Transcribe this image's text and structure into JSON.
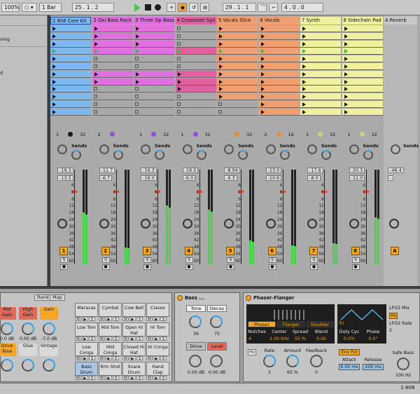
{
  "toolbar": {
    "zoom": "100%",
    "quantize": "1 Bar",
    "pos_bar": "25",
    "pos_beat": "1",
    "pos_sixteenth": "2",
    "loop_bar": "29",
    "loop_beat": "1",
    "loop_sixteenth": "1",
    "length_bar": "4",
    "length_beat": "0",
    "length_sixteenth": "0"
  },
  "browser": {
    "items": [
      "ving",
      "d"
    ]
  },
  "tracks": [
    {
      "name": "1 808 Core Kit",
      "color": "#7db8f0",
      "selected": true,
      "clips": [
        1,
        1,
        1,
        1,
        1,
        1,
        1,
        1,
        1,
        1,
        1,
        1
      ],
      "playing_row": 3,
      "status_a": "1",
      "status_b": "32",
      "dot_color": "#1a1a1a",
      "sends": "Sends",
      "vol": "-19.3",
      "peak": "-13.5",
      "meter": 0.55,
      "num": "1"
    },
    {
      "name": "2 Oxi Bass Rack",
      "color": "#e070e0",
      "selected": false,
      "clips": [
        1,
        1,
        1,
        1,
        0,
        0,
        1,
        1,
        0,
        0,
        0,
        0
      ],
      "playing_row": 3,
      "status_a": "2",
      "status_b": "",
      "dot_color": "#9050d0",
      "sends": "Sends",
      "vol": "-11.7",
      "peak": "-6.7",
      "meter": 0.18,
      "num": "2"
    },
    {
      "name": "3 Three Op Bass",
      "color": "#e070e0",
      "selected": false,
      "clips": [
        1,
        1,
        1,
        1,
        0,
        0,
        1,
        1,
        0,
        0,
        0,
        0
      ],
      "playing_row": 3,
      "status_a": "1",
      "status_b": "32",
      "dot_color": "#9050d0",
      "sends": "Sends",
      "vol": "-16.3",
      "peak": "-16.0",
      "meter": 0.62,
      "num": "3"
    },
    {
      "name": "4 Crossover Syn",
      "color": "#e060a0",
      "selected": false,
      "clips": [
        0,
        0,
        0,
        1,
        0,
        0,
        1,
        1,
        1,
        0,
        0,
        0
      ],
      "playing_row": 3,
      "status_a": "1",
      "status_b": "32",
      "dot_color": "#9050d0",
      "sends": "Sends",
      "vol": "-18.0",
      "peak": "-6.0",
      "meter": 0.58,
      "num": "4"
    },
    {
      "name": "5 Vocals Slice",
      "color": "#f0a070",
      "selected": false,
      "clips": [
        1,
        1,
        1,
        1,
        1,
        1,
        1,
        1,
        1,
        1,
        0,
        0
      ],
      "playing_row": 3,
      "status_a": "",
      "status_b": "32",
      "dot_color": "#e09040",
      "sends": "Sends",
      "vol": "-8.94",
      "peak": "-9.3",
      "meter": 0.25,
      "num": "5"
    },
    {
      "name": "6 Vocals",
      "color": "#f0a070",
      "selected": false,
      "clips": [
        1,
        1,
        1,
        1,
        1,
        1,
        1,
        1,
        1,
        1,
        1,
        1
      ],
      "playing_row": 3,
      "status_a": "2",
      "status_b": "16",
      "dot_color": "#e09040",
      "sends": "Sends",
      "vol": "-13.0",
      "peak": "-10.6",
      "meter": 0.2,
      "num": "6"
    },
    {
      "name": "7 Synth",
      "color": "#f0f0a0",
      "selected": false,
      "clips": [
        1,
        1,
        1,
        1,
        1,
        1,
        1,
        1,
        1,
        1,
        1,
        1
      ],
      "playing_row": 3,
      "status_a": "1",
      "status_b": "32",
      "dot_color": "#d0d080",
      "sends": "Sends",
      "vol": "-17.6",
      "peak": "-8.0",
      "meter": 0.22,
      "num": "7"
    },
    {
      "name": "8 Sidechain Pad",
      "color": "#f0f0a0",
      "selected": false,
      "clips": [
        1,
        1,
        1,
        1,
        1,
        1,
        1,
        1,
        1,
        1,
        1,
        1
      ],
      "playing_row": 3,
      "status_a": "1",
      "status_b": "32",
      "dot_color": "#d0d080",
      "sends": "Sends",
      "vol": "-20.3",
      "peak": "-12.0",
      "meter": 0.5,
      "num": "8"
    }
  ],
  "return_track": {
    "name": "A Reverb",
    "sends": "Sends",
    "vol": "-46.4",
    "peak": "-",
    "num": "A"
  },
  "fader_ticks": [
    "6",
    "0",
    "6",
    "12",
    "18",
    "24",
    "30",
    "36",
    "42",
    "48",
    "54",
    "60"
  ],
  "drum_rack": {
    "tabs": [
      "Rand",
      "Map"
    ],
    "macro_labels": [
      [
        "Mid Gain",
        "High Gain",
        "Gain"
      ],
      [
        "Drive Tone",
        "Glue",
        "Vintage"
      ]
    ],
    "macro_values": [
      "0.0 dB",
      "0.00 dB",
      "-7.0 dB",
      "",
      "",
      ""
    ],
    "pads": [
      [
        "Maracas",
        "Cymbal",
        "Cow Bell",
        "Claves"
      ],
      [
        "Low Tom",
        "Mid Tom",
        "Open Hi Hat",
        "Hi Tom"
      ],
      [
        "Low Conga",
        "Mid Conga",
        "Closed Hi Hat",
        "Hi Conga"
      ],
      [
        "Bass Drum",
        "Rim Shot",
        "Snare Drum",
        "Hand Clap"
      ]
    ]
  },
  "bass_device": {
    "title": "Bass ...",
    "tone_label": "Tone",
    "decay_label": "Decay",
    "tone_value": "36",
    "decay_value": "75",
    "drive_label": "Drive",
    "level_label": "Level",
    "drive_value": "0.00 dB",
    "level_value": "0.00 dB"
  },
  "phaser": {
    "title": "Phaser-Flanger",
    "modes": [
      "Phaser",
      "Flanger",
      "Doubler"
    ],
    "notches_label": "Notches",
    "notches_value": "4",
    "center_label": "Center",
    "center_value": "1.00 kHz",
    "spread_label": "Spread",
    "spread_value": "50 %",
    "blend_label": "Blend",
    "blend_value": "0.00",
    "wave_label": "Tri",
    "duty_label": "Duty Cyc",
    "duty_value": "0.0%",
    "phase_label": "Phase",
    "phase_value": "0.0°",
    "lfo2_mix_label": "LFO2 Mix",
    "lfo2_rate_label": "LFO2 Rate",
    "lfo2_rate_value": "2",
    "hz_label": "Hz",
    "rate_label": "Rate",
    "rate_value": "2",
    "amount_label": "Amount",
    "amount_value": "65 %",
    "feedback_label": "Feedback",
    "feedback_value": "0",
    "env_fol_label": "Env Fol",
    "attack_label": "Attack",
    "attack_value": "6.00 ms",
    "release_label": "Release",
    "release_value": "200 ms",
    "safe_bass_label": "Safe Bass",
    "safe_bass_value": "100 Hz"
  },
  "status_bar": {
    "right_label": "1-808"
  }
}
